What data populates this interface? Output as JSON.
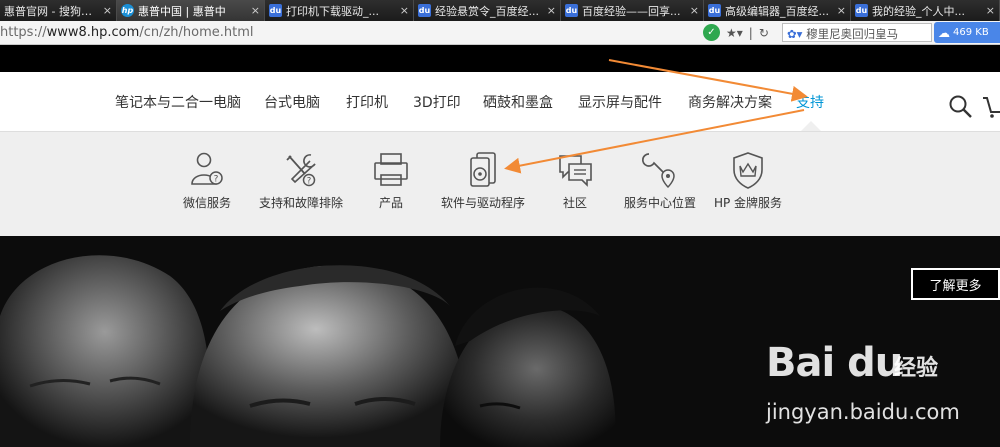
{
  "browser": {
    "tabs": [
      {
        "title": "惠普官网 - 搜狗搜索",
        "icon": "sogou-icon",
        "active": false
      },
      {
        "title": "惠普中国 | 惠普中",
        "icon": "hp-logo-icon",
        "active": true
      },
      {
        "title": "打印机下载驱动_...",
        "icon": "baidu-paw-icon",
        "active": false
      },
      {
        "title": "经验悬赏令_百度经...",
        "icon": "baidu-paw-icon",
        "active": false
      },
      {
        "title": "百度经验——回享...",
        "icon": "baidu-paw-icon",
        "active": false
      },
      {
        "title": "高级编辑器_百度经...",
        "icon": "baidu-paw-icon",
        "active": false
      },
      {
        "title": "我的经验_个人中...",
        "icon": "baidu-paw-icon",
        "active": false
      }
    ],
    "close_glyph": "×",
    "url_scheme": "https://",
    "url_host": "www8.hp.com",
    "url_path": "/cn/zh/home.html",
    "search_placeholder": "穆里尼奥回归皇马",
    "speed_text": "469 KB"
  },
  "nav": {
    "items": [
      "笔记本与二合一电脑",
      "台式电脑",
      "打印机",
      "3D打印",
      "硒鼓和墨盒",
      "显示屏与配件",
      "商务解决方案",
      "支持"
    ],
    "active_index": 7
  },
  "support_menu": {
    "items": [
      {
        "label": "微信服务",
        "icon": "user-question-icon"
      },
      {
        "label": "支持和故障排除",
        "icon": "tools-question-icon"
      },
      {
        "label": "产品",
        "icon": "printer-icon"
      },
      {
        "label": "软件与驱动程序",
        "icon": "disc-driver-icon"
      },
      {
        "label": "社区",
        "icon": "chat-bubbles-icon"
      },
      {
        "label": "服务中心位置",
        "icon": "wrench-location-icon"
      },
      {
        "label": "HP 金牌服务",
        "icon": "shield-crown-icon"
      }
    ]
  },
  "hero": {
    "learn_more": "了解更多"
  },
  "watermark": {
    "brand": "Bai du",
    "brand_cn": "经验",
    "url": "jingyan.baidu.com"
  },
  "colors": {
    "active_nav": "#0096d6",
    "arrow": "#f28a35",
    "menu_bg": "#efefef"
  }
}
